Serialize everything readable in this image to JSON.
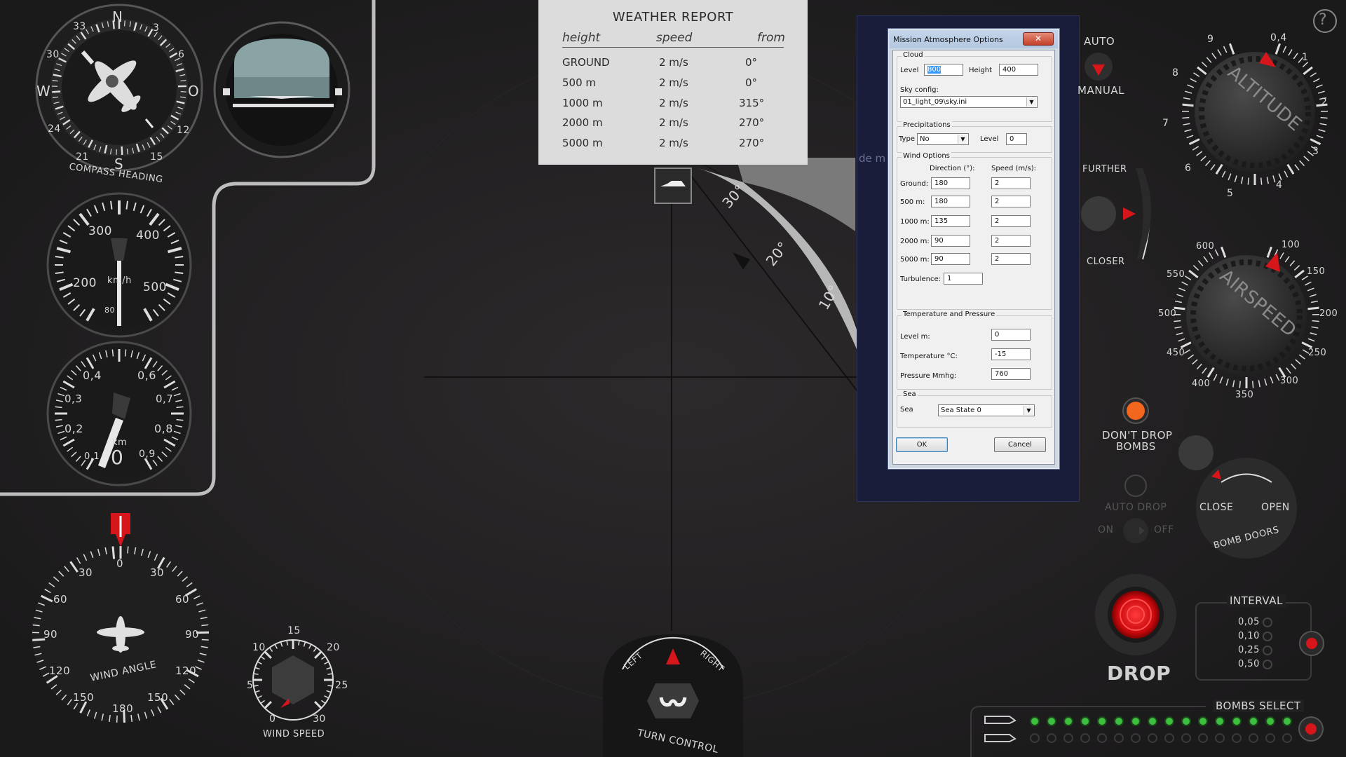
{
  "help": {
    "symbol": "?"
  },
  "colors": {
    "accent_red": "#d6161b",
    "lamp_orange": "#f2661e",
    "lamp_green": "#3fbf3f",
    "panel_bg": "#212021"
  },
  "compass": {
    "label": "COMPASS HEADING",
    "cardinals": {
      "n": "N",
      "e": "O",
      "s": "S",
      "w": "W"
    },
    "numbers": [
      "3",
      "6",
      "12",
      "15",
      "21",
      "24",
      "30",
      "33"
    ]
  },
  "airspeed_kmh": {
    "unit": "km/h",
    "ticks": [
      "200",
      "300",
      "400",
      "500"
    ],
    "sub": "80"
  },
  "altimeter_km": {
    "unit": "km",
    "ticks": [
      "0,1",
      "0,2",
      "0,3",
      "0,4",
      "0,6",
      "0,7",
      "0,8",
      "0,9"
    ],
    "value": "0"
  },
  "wind_angle": {
    "label": "WIND ANGLE",
    "ticks": {
      "top": "0",
      "l30": "30",
      "r30": "30",
      "l60": "60",
      "r60": "60",
      "l90": "90",
      "r90": "90",
      "l120": "120",
      "r120": "120",
      "l150": "150",
      "r150": "150",
      "bottom": "180"
    }
  },
  "wind_speed": {
    "label": "WIND SPEED",
    "ticks": {
      "t0": "0",
      "t5": "5",
      "t10": "10",
      "t15": "15",
      "t20": "20",
      "t25": "25",
      "t30": "30"
    }
  },
  "weather_report": {
    "title": "WEATHER REPORT",
    "columns": {
      "height": "height",
      "speed": "speed",
      "from": "from"
    },
    "rows": [
      {
        "height": "GROUND",
        "speed": "2 m/s",
        "from": "0°"
      },
      {
        "height": "500 m",
        "speed": "2 m/s",
        "from": "0°"
      },
      {
        "height": "1000 m",
        "speed": "2 m/s",
        "from": "315°"
      },
      {
        "height": "2000 m",
        "speed": "2 m/s",
        "from": "270°"
      },
      {
        "height": "5000 m",
        "speed": "2 m/s",
        "from": "270°"
      }
    ]
  },
  "sight": {
    "marks": {
      "m30": "30°",
      "m20": "20°",
      "m10": "10°"
    }
  },
  "turn_control": {
    "label": "TURN CONTROL",
    "left": "LEFT",
    "right": "RIGHT"
  },
  "map_fragment": {
    "text": "de  m"
  },
  "dialog": {
    "title": "Mission Atmosphere Options",
    "close": "✕",
    "cloud": {
      "group": "Cloud",
      "level_label": "Level",
      "level_value": "800",
      "height_label": "Height",
      "height_value": "400",
      "sky_label": "Sky config:",
      "sky_value": "01_light_09\\sky.ini"
    },
    "precip": {
      "group": "Precipitations",
      "type_label": "Type",
      "type_value": "No",
      "level_label": "Level",
      "level_value": "0"
    },
    "wind": {
      "group": "Wind Options",
      "dir_header": "Direction (°):",
      "speed_header": "Speed (m/s):",
      "rows": [
        {
          "label": "Ground:",
          "dir": "180",
          "speed": "2"
        },
        {
          "label": "500 m:",
          "dir": "180",
          "speed": "2"
        },
        {
          "label": "1000 m:",
          "dir": "135",
          "speed": "2"
        },
        {
          "label": "2000 m:",
          "dir": "90",
          "speed": "2"
        },
        {
          "label": "5000 m:",
          "dir": "90",
          "speed": "2"
        }
      ],
      "turbulence_label": "Turbulence:",
      "turbulence_value": "1"
    },
    "temp": {
      "group": "Temperature and Pressure",
      "level_label": "Level m:",
      "level_value": "0",
      "temp_label": "Temperature °C:",
      "temp_value": "-15",
      "press_label": "Pressure Mmhg:",
      "press_value": "760"
    },
    "sea": {
      "group": "Sea",
      "label": "Sea",
      "value": "Sea State 0"
    },
    "ok": "OK",
    "cancel": "Cancel"
  },
  "altitude_switch": {
    "auto": "AUTO",
    "manual": "MANUAL"
  },
  "distance": {
    "further": "FURTHER",
    "closer": "CLOSER"
  },
  "altitude_dial": {
    "label": "ALTITUDE",
    "ticks": {
      "t04": "0,4",
      "t1": "1",
      "t2": "2",
      "t3": "3",
      "t4": "4",
      "t5": "5",
      "t6": "6",
      "t7": "7",
      "t8": "8",
      "t9": "9"
    }
  },
  "airspeed_dial": {
    "label": "AIRSPEED",
    "ticks": {
      "t100": "100",
      "t150": "150",
      "t200": "200",
      "t250": "250",
      "t300": "300",
      "t350": "350",
      "t400": "400",
      "t450": "450",
      "t500": "500",
      "t550": "550",
      "t600": "600"
    }
  },
  "bomb_lamp": {
    "label_1": "DON'T DROP",
    "label_2": "BOMBS"
  },
  "auto_drop": {
    "label": "AUTO DROP",
    "on": "ON",
    "off": "OFF"
  },
  "bomb_doors": {
    "close": "CLOSE",
    "open": "OPEN",
    "label": "BOMB DOORS"
  },
  "drop": {
    "label": "DROP"
  },
  "interval": {
    "title": "INTERVAL",
    "options": [
      "0,05",
      "0,10",
      "0,25",
      "0,50"
    ]
  },
  "bombs_select": {
    "title": "BOMBS SELECT"
  }
}
